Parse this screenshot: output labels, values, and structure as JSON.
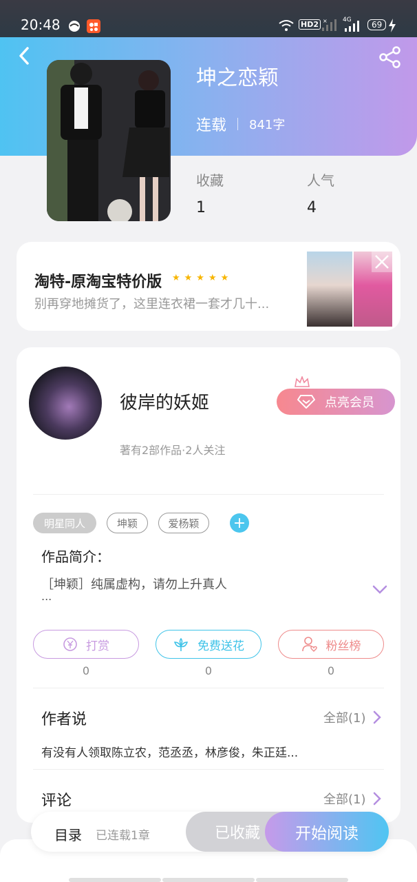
{
  "status_bar": {
    "time": "20:48",
    "hd_label": "HD2",
    "network_label": "4G",
    "battery": "69"
  },
  "book": {
    "title": "坤之恋颖",
    "serial_status": "连载",
    "word_count": "841字",
    "favorites_label": "收藏",
    "favorites_value": "1",
    "popularity_label": "人气",
    "popularity_value": "4"
  },
  "ad": {
    "title": "淘特-原淘宝特价版",
    "stars": "★★★★★",
    "description": "别再穿地摊货了，这里连衣裙一套才几十..."
  },
  "author": {
    "name": "彼岸的妖姬",
    "meta": "著有2部作品·2人关注",
    "vip_label": "点亮会员"
  },
  "tags": [
    "明星同人",
    "坤颖",
    "爱杨颖"
  ],
  "tag_add_symbol": "+",
  "intro": {
    "label": "作品简介：",
    "text": "［坤颖］纯属虚构，请勿上升真人",
    "ellipsis": "..."
  },
  "actions": [
    {
      "label": "打赏",
      "count": "0",
      "color": "#c79ae0"
    },
    {
      "label": "免费送花",
      "count": "0",
      "color": "#3fc3e8"
    },
    {
      "label": "粉丝榜",
      "count": "0",
      "color": "#ee8a8a"
    }
  ],
  "author_says": {
    "title": "作者说",
    "all_label": "全部(1)",
    "text": "有没有人领取陈立农，范丞丞，林彦俊，朱正廷..."
  },
  "comments": {
    "title": "评论",
    "all_label": "全部(1)"
  },
  "bottom_bar": {
    "toc_label": "目录",
    "chapter_status": "已连载1章",
    "collected_label": "已收藏",
    "read_label": "开始阅读"
  },
  "colors": {
    "header_start": "#4fc3f2",
    "header_end": "#c199ea",
    "accent_purple": "#c79ae0",
    "accent_blue": "#3fc3e8",
    "accent_red": "#ee8a8a"
  }
}
